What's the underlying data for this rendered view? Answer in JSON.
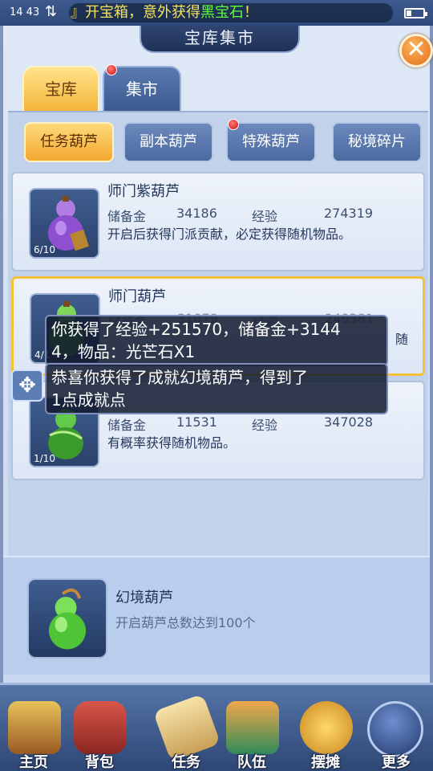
{
  "status_bar": {
    "time": "14 43",
    "marquee_prefix": "』开宝箱，意外获得",
    "marquee_highlight": "黑宝石",
    "marquee_suffix": "！"
  },
  "header": {
    "title": "宝库集市"
  },
  "tabs": [
    {
      "label": "宝库",
      "active": true
    },
    {
      "label": "集市",
      "has_dot": true
    }
  ],
  "sub_tabs": [
    {
      "label": "任务葫芦",
      "active": true
    },
    {
      "label": "副本葫芦"
    },
    {
      "label": "特殊葫芦",
      "has_dot": true
    },
    {
      "label": "秘境碎片"
    }
  ],
  "items": [
    {
      "name": "师门紫葫芦",
      "count": "6/10",
      "reserve_label": "储备金",
      "reserve_value": "34186",
      "exp_label": "经验",
      "exp_value": "274319",
      "desc": "开启后获得门派贡献，必定获得随机物品。",
      "color": "#9b5bd6"
    },
    {
      "name": "师门葫芦",
      "count": "4/1",
      "reserve_label": "储备金",
      "reserve_value": "31079",
      "exp_label": "经验",
      "exp_value": "249381",
      "desc_tail": "随",
      "color": "#5cbf3a"
    },
    {
      "name": "",
      "count": "1/10",
      "reserve_label": "储备金",
      "reserve_value": "11531",
      "exp_label": "经验",
      "exp_value": "347028",
      "desc": "有概率获得随机物品。",
      "color": "#48b83a"
    }
  ],
  "toasts": [
    {
      "line1": "你获得了经验+251570，储备金+3144",
      "line2": "4，物品：光芒石X1"
    },
    {
      "line1": "恭喜你获得了成就幻境葫芦，得到了",
      "line2": "1点成就点"
    }
  ],
  "achievement": {
    "name": "幻境葫芦",
    "desc": "开启葫芦总数达到100个"
  },
  "nav": [
    {
      "label": "主页",
      "icon": "house-icon"
    },
    {
      "label": "背包",
      "icon": "chest-icon"
    },
    {
      "label": "任务",
      "icon": "scroll-icon"
    },
    {
      "label": "队伍",
      "icon": "team-icon"
    },
    {
      "label": "摆摊",
      "icon": "coin-icon"
    },
    {
      "label": "更多",
      "icon": "more-icon"
    }
  ],
  "colors": {
    "accent_gold": "#f3c13c",
    "panel_blue": "#c2d2ea",
    "marquee_yellow": "#f5e25a",
    "marquee_green": "#5dff3a"
  }
}
